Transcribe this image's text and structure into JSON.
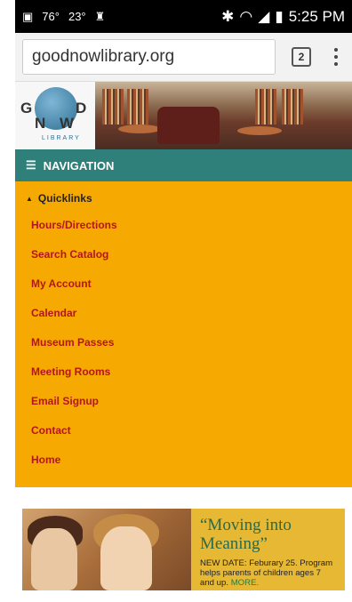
{
  "status_bar": {
    "temp1": "76°",
    "temp2": "23°",
    "time": "5:25 PM"
  },
  "browser": {
    "url": "goodnowlibrary.org",
    "tab_count": "2"
  },
  "logo": {
    "g": "G",
    "d": "D",
    "n": "N",
    "w": "W",
    "sub": "LIBRARY"
  },
  "nav": {
    "label": "NAVIGATION",
    "quicklinks": "Quicklinks",
    "items": [
      {
        "label": "Hours/Directions"
      },
      {
        "label": "Search Catalog"
      },
      {
        "label": "My Account"
      },
      {
        "label": "Calendar"
      },
      {
        "label": "Museum Passes"
      },
      {
        "label": "Meeting Rooms"
      },
      {
        "label": "Email Signup"
      },
      {
        "label": "Contact"
      },
      {
        "label": "Home"
      }
    ]
  },
  "promo": {
    "title": "“Moving into Meaning”",
    "desc": "NEW DATE: Feburary 25. Program helps parents of children ages 7 and up.",
    "more": "MORE."
  },
  "colors": {
    "nav_bar": "#2f7f7a",
    "nav_bg": "#f6a900",
    "link": "#b5161c",
    "promo_bg": "#e7b833"
  }
}
